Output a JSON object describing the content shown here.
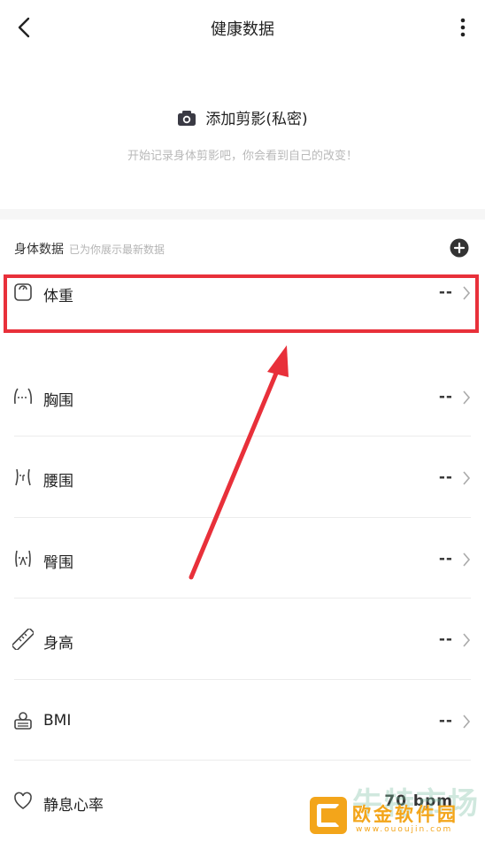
{
  "header": {
    "title": "健康数据"
  },
  "photo": {
    "add_label": "添加剪影(私密)",
    "hint": "开始记录身体剪影吧，你会看到自己的改变！"
  },
  "section": {
    "title": "身体数据",
    "subtitle": "已为你展示最新数据"
  },
  "metrics": [
    {
      "name": "体重",
      "value": "--",
      "icon": "scale-icon"
    },
    {
      "name": "胸围",
      "value": "--",
      "icon": "chest-icon"
    },
    {
      "name": "腰围",
      "value": "--",
      "icon": "waist-icon"
    },
    {
      "name": "臀围",
      "value": "--",
      "icon": "hip-icon"
    },
    {
      "name": "身高",
      "value": "--",
      "icon": "ruler-icon"
    },
    {
      "name": "BMI",
      "value": "--",
      "icon": "bmi-scale-icon"
    },
    {
      "name": "静息心率",
      "value": "70 bpm",
      "icon": "heart-icon"
    }
  ],
  "watermark": {
    "big": "牛特市场",
    "text": "欧金软件园",
    "url": "www.ououjin.com"
  },
  "colors": {
    "highlight": "#e8303a",
    "accent_dark": "#333333",
    "hint": "#b9b9b9"
  }
}
